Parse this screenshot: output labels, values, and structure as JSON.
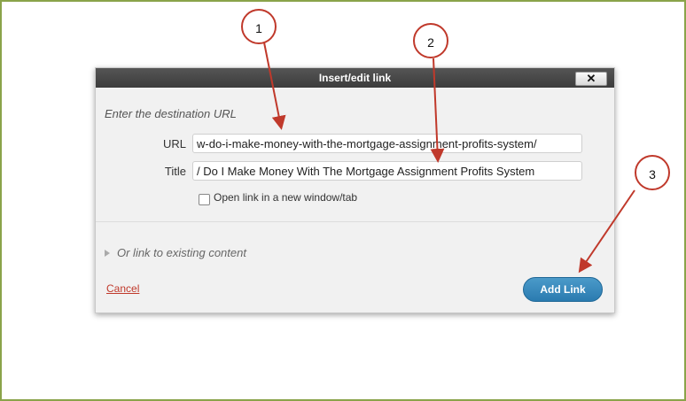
{
  "dialog": {
    "title": "Insert/edit link",
    "close_label": "✕",
    "prompt": "Enter the destination URL",
    "url_label": "URL",
    "url_value": "w-do-i-make-money-with-the-mortgage-assignment-profits-system/",
    "title_label": "Title",
    "title_value": "/ Do I Make Money With The Mortgage Assignment Profits System",
    "new_window_label": "Open link in a new window/tab",
    "existing_content_label": "Or link to existing content",
    "cancel_label": "Cancel",
    "add_link_label": "Add Link"
  },
  "callouts": [
    "1",
    "2",
    "3"
  ],
  "colors": {
    "frame": "#8aa34a",
    "callout": "#c0392b",
    "primary_button": "#2a7bb0",
    "cancel": "#c0392b"
  },
  "icons": {
    "close": "close-icon",
    "checkbox": "checkbox-icon",
    "expand": "triangle-right-icon"
  }
}
